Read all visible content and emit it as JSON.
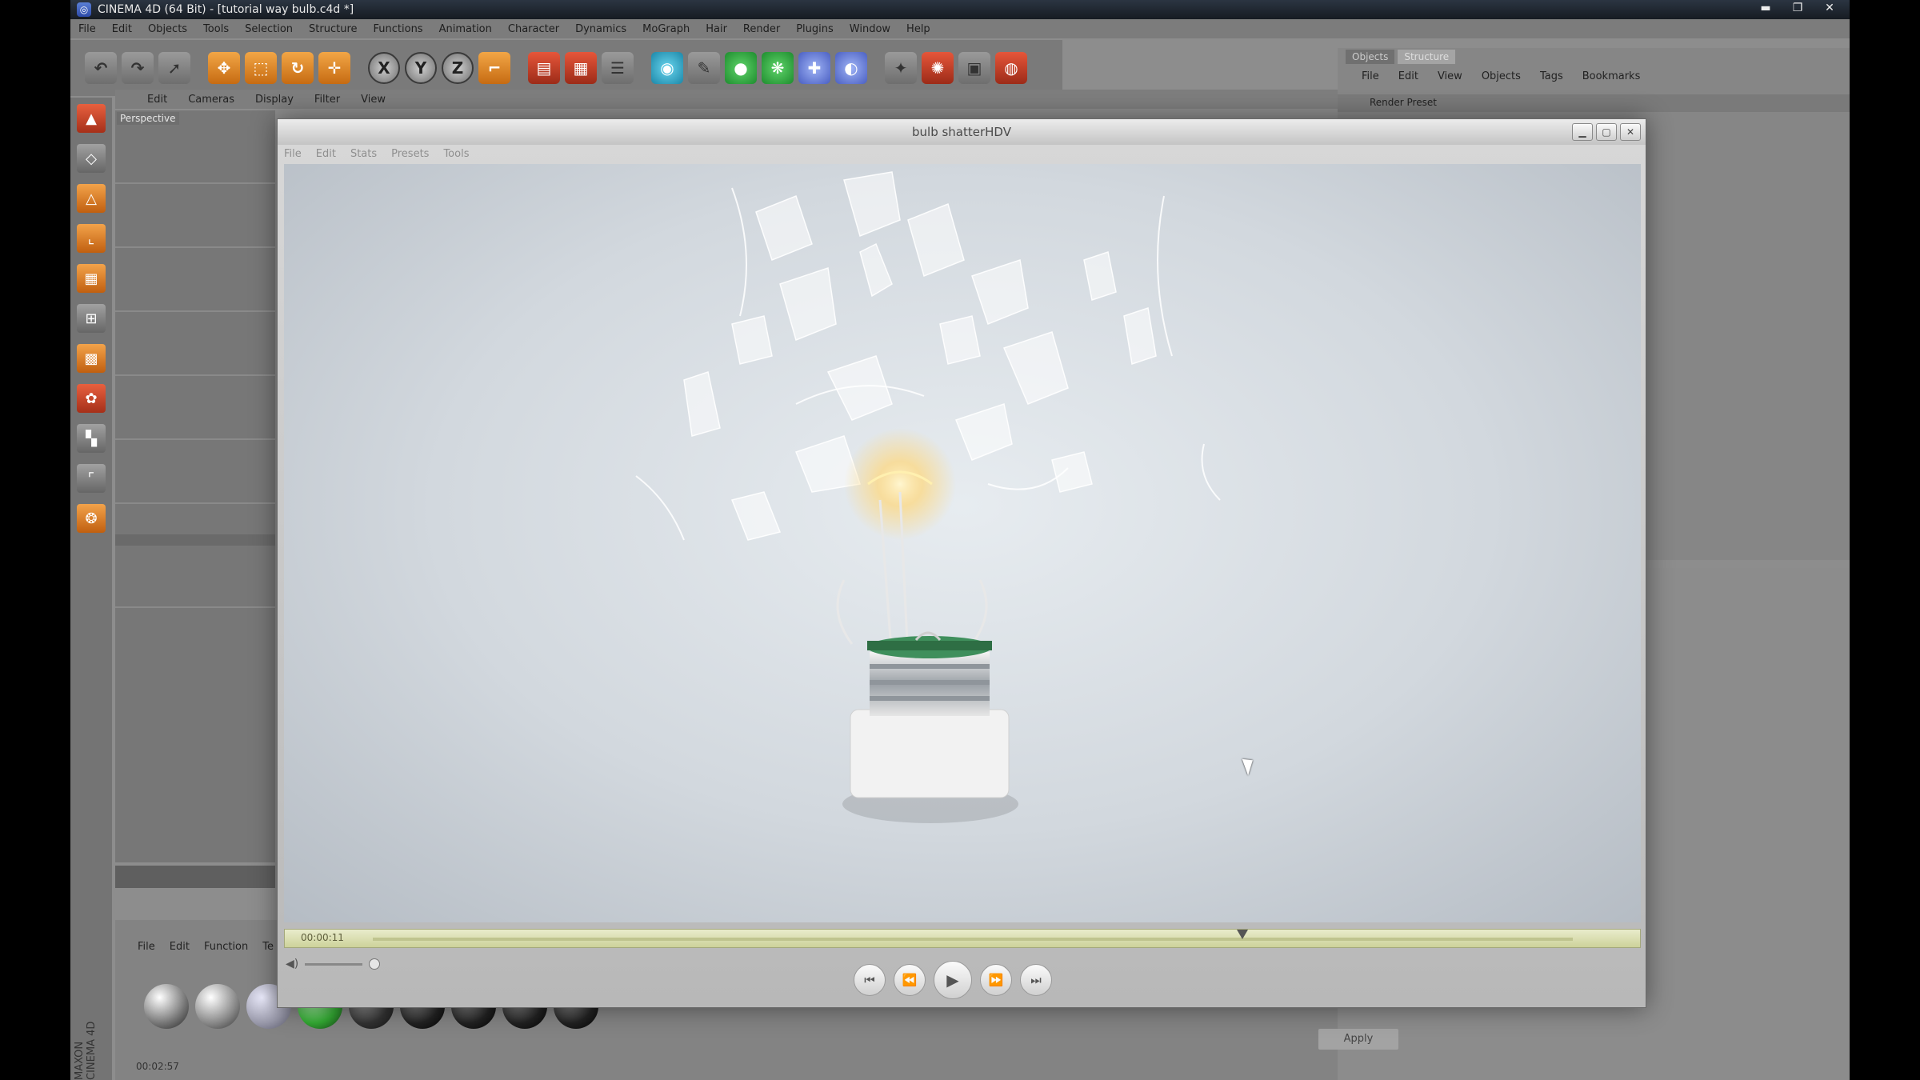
{
  "titlebar": {
    "title": "CINEMA 4D (64 Bit) - [tutorial way bulb.c4d *]",
    "min": "▬",
    "max": "❐",
    "close": "✕"
  },
  "menubar": [
    "File",
    "Edit",
    "Objects",
    "Tools",
    "Selection",
    "Structure",
    "Functions",
    "Animation",
    "Character",
    "Dynamics",
    "MoGraph",
    "Hair",
    "Render",
    "Plugins",
    "Window",
    "Help"
  ],
  "toolbar": {
    "icons": [
      {
        "name": "undo-icon",
        "g": "↶",
        "c": "gray"
      },
      {
        "name": "redo-icon",
        "g": "↷",
        "c": "gray"
      },
      {
        "name": "select-icon",
        "g": "➚",
        "c": "gray"
      },
      {
        "name": "move-icon",
        "g": "✥",
        "c": "orange"
      },
      {
        "name": "scale-icon",
        "g": "⬚",
        "c": "orange"
      },
      {
        "name": "rotate-icon",
        "g": "↻",
        "c": "orange"
      },
      {
        "name": "world-axis-icon",
        "g": "✛",
        "c": "orange"
      },
      {
        "name": "x-axis-icon",
        "g": "X",
        "c": "circle"
      },
      {
        "name": "y-axis-icon",
        "g": "Y",
        "c": "circle"
      },
      {
        "name": "z-axis-icon",
        "g": "Z",
        "c": "circle"
      },
      {
        "name": "coord-system-icon",
        "g": "⌐",
        "c": "orange"
      },
      {
        "name": "render-view-icon",
        "g": "▤",
        "c": "red"
      },
      {
        "name": "render-pv-icon",
        "g": "▦",
        "c": "red"
      },
      {
        "name": "render-settings-icon",
        "g": "☰",
        "c": "gray"
      },
      {
        "name": "cube-icon",
        "g": "◉",
        "c": "teal"
      },
      {
        "name": "spline-icon",
        "g": "✎",
        "c": "gray"
      },
      {
        "name": "nurbs-icon",
        "g": "●",
        "c": "green"
      },
      {
        "name": "array-icon",
        "g": "❋",
        "c": "green"
      },
      {
        "name": "deformer-icon",
        "g": "✚",
        "c": "blue"
      },
      {
        "name": "environment-icon",
        "g": "◐",
        "c": "blue"
      },
      {
        "name": "camera-icon",
        "g": "✦",
        "c": "gray"
      },
      {
        "name": "light-icon",
        "g": "✺",
        "c": "red"
      },
      {
        "name": "scene-icon",
        "g": "▣",
        "c": "gray"
      },
      {
        "name": "record-icon",
        "g": "◍",
        "c": "red"
      }
    ]
  },
  "viewport": {
    "menu": [
      "Edit",
      "Cameras",
      "Display",
      "Filter",
      "View"
    ],
    "label": "Perspective"
  },
  "material": {
    "menu": [
      "File",
      "Edit",
      "Function",
      "Te"
    ],
    "status_time": "00:02:57",
    "brand": "MAXON CINEMA 4D"
  },
  "object_manager": {
    "tabs": [
      "Objects",
      "Structure"
    ],
    "menu": [
      "File",
      "Edit",
      "View",
      "Objects",
      "Tags",
      "Bookmarks"
    ],
    "row_label": "Render Preset"
  },
  "attributes": {
    "apply_label": "Apply"
  },
  "picture_viewer": {
    "title": "bulb shatterHDV",
    "menu": [
      "File",
      "Edit",
      "Stats",
      "Presets",
      "Tools"
    ],
    "timecode": "00:00:11",
    "controls": [
      {
        "name": "goto-start-button",
        "g": "⏮"
      },
      {
        "name": "step-back-button",
        "g": "⏪"
      },
      {
        "name": "play-button",
        "g": "▶"
      },
      {
        "name": "step-forward-button",
        "g": "⏩"
      },
      {
        "name": "goto-end-button",
        "g": "⏭"
      }
    ]
  }
}
